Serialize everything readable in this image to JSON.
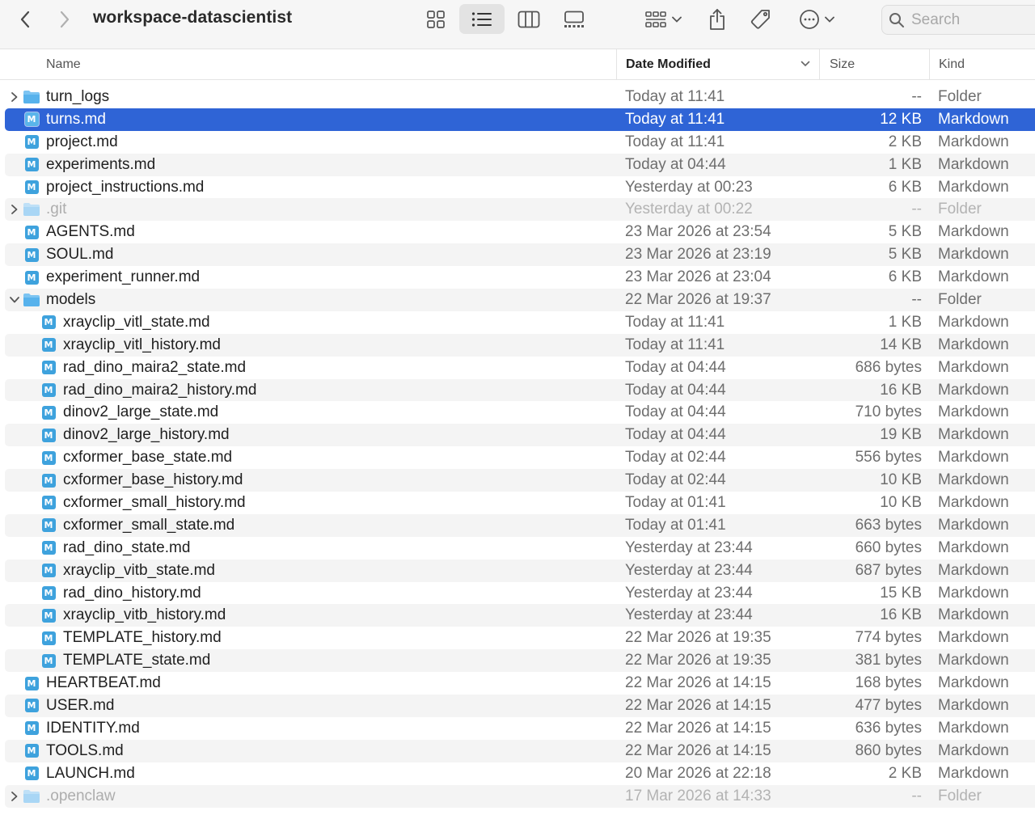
{
  "window": {
    "title": "workspace-datascientist"
  },
  "search": {
    "placeholder": "Search"
  },
  "columns": {
    "name": "Name",
    "date": "Date Modified",
    "size": "Size",
    "kind": "Kind"
  },
  "colors": {
    "selection": "#2f64d6",
    "folder": "#57b2ec",
    "markdown_icon": "#3ea2dd"
  },
  "icons": {
    "toolbar": [
      "chevron-left-icon",
      "chevron-right-icon",
      "grid-view-icon",
      "list-view-icon",
      "columns-view-icon",
      "gallery-view-icon",
      "group-icon",
      "share-icon",
      "tag-icon",
      "more-icon",
      "search-icon"
    ],
    "file_types": {
      "folder": "folder-icon",
      "markdown": "markdown-file-icon"
    }
  },
  "files": [
    {
      "name": "turn_logs",
      "date": "Today at 11:41",
      "size": "--",
      "kind": "Folder",
      "type": "folder",
      "level": 0,
      "expanded": false,
      "hidden": false,
      "selected": false
    },
    {
      "name": "turns.md",
      "date": "Today at 11:41",
      "size": "12 KB",
      "kind": "Markdown",
      "type": "md",
      "level": 0,
      "selected": true
    },
    {
      "name": "project.md",
      "date": "Today at 11:41",
      "size": "2 KB",
      "kind": "Markdown",
      "type": "md",
      "level": 0
    },
    {
      "name": "experiments.md",
      "date": "Today at 04:44",
      "size": "1 KB",
      "kind": "Markdown",
      "type": "md",
      "level": 0
    },
    {
      "name": "project_instructions.md",
      "date": "Yesterday at 00:23",
      "size": "6 KB",
      "kind": "Markdown",
      "type": "md",
      "level": 0
    },
    {
      "name": ".git",
      "date": "Yesterday at 00:22",
      "size": "--",
      "kind": "Folder",
      "type": "folder",
      "level": 0,
      "expanded": false,
      "hidden": true
    },
    {
      "name": "AGENTS.md",
      "date": "23 Mar 2026 at 23:54",
      "size": "5 KB",
      "kind": "Markdown",
      "type": "md",
      "level": 0
    },
    {
      "name": "SOUL.md",
      "date": "23 Mar 2026 at 23:19",
      "size": "5 KB",
      "kind": "Markdown",
      "type": "md",
      "level": 0
    },
    {
      "name": "experiment_runner.md",
      "date": "23 Mar 2026 at 23:04",
      "size": "6 KB",
      "kind": "Markdown",
      "type": "md",
      "level": 0
    },
    {
      "name": "models",
      "date": "22 Mar 2026 at 19:37",
      "size": "--",
      "kind": "Folder",
      "type": "folder",
      "level": 0,
      "expanded": true,
      "hidden": false
    },
    {
      "name": "xrayclip_vitl_state.md",
      "date": "Today at 11:41",
      "size": "1 KB",
      "kind": "Markdown",
      "type": "md",
      "level": 1
    },
    {
      "name": "xrayclip_vitl_history.md",
      "date": "Today at 11:41",
      "size": "14 KB",
      "kind": "Markdown",
      "type": "md",
      "level": 1
    },
    {
      "name": "rad_dino_maira2_state.md",
      "date": "Today at 04:44",
      "size": "686 bytes",
      "kind": "Markdown",
      "type": "md",
      "level": 1
    },
    {
      "name": "rad_dino_maira2_history.md",
      "date": "Today at 04:44",
      "size": "16 KB",
      "kind": "Markdown",
      "type": "md",
      "level": 1
    },
    {
      "name": "dinov2_large_state.md",
      "date": "Today at 04:44",
      "size": "710 bytes",
      "kind": "Markdown",
      "type": "md",
      "level": 1
    },
    {
      "name": "dinov2_large_history.md",
      "date": "Today at 04:44",
      "size": "19 KB",
      "kind": "Markdown",
      "type": "md",
      "level": 1
    },
    {
      "name": "cxformer_base_state.md",
      "date": "Today at 02:44",
      "size": "556 bytes",
      "kind": "Markdown",
      "type": "md",
      "level": 1
    },
    {
      "name": "cxformer_base_history.md",
      "date": "Today at 02:44",
      "size": "10 KB",
      "kind": "Markdown",
      "type": "md",
      "level": 1
    },
    {
      "name": "cxformer_small_history.md",
      "date": "Today at 01:41",
      "size": "10 KB",
      "kind": "Markdown",
      "type": "md",
      "level": 1
    },
    {
      "name": "cxformer_small_state.md",
      "date": "Today at 01:41",
      "size": "663 bytes",
      "kind": "Markdown",
      "type": "md",
      "level": 1
    },
    {
      "name": "rad_dino_state.md",
      "date": "Yesterday at 23:44",
      "size": "660 bytes",
      "kind": "Markdown",
      "type": "md",
      "level": 1
    },
    {
      "name": "xrayclip_vitb_state.md",
      "date": "Yesterday at 23:44",
      "size": "687 bytes",
      "kind": "Markdown",
      "type": "md",
      "level": 1
    },
    {
      "name": "rad_dino_history.md",
      "date": "Yesterday at 23:44",
      "size": "15 KB",
      "kind": "Markdown",
      "type": "md",
      "level": 1
    },
    {
      "name": "xrayclip_vitb_history.md",
      "date": "Yesterday at 23:44",
      "size": "16 KB",
      "kind": "Markdown",
      "type": "md",
      "level": 1
    },
    {
      "name": "TEMPLATE_history.md",
      "date": "22 Mar 2026 at 19:35",
      "size": "774 bytes",
      "kind": "Markdown",
      "type": "md",
      "level": 1
    },
    {
      "name": "TEMPLATE_state.md",
      "date": "22 Mar 2026 at 19:35",
      "size": "381 bytes",
      "kind": "Markdown",
      "type": "md",
      "level": 1
    },
    {
      "name": "HEARTBEAT.md",
      "date": "22 Mar 2026 at 14:15",
      "size": "168 bytes",
      "kind": "Markdown",
      "type": "md",
      "level": 0
    },
    {
      "name": "USER.md",
      "date": "22 Mar 2026 at 14:15",
      "size": "477 bytes",
      "kind": "Markdown",
      "type": "md",
      "level": 0
    },
    {
      "name": "IDENTITY.md",
      "date": "22 Mar 2026 at 14:15",
      "size": "636 bytes",
      "kind": "Markdown",
      "type": "md",
      "level": 0
    },
    {
      "name": "TOOLS.md",
      "date": "22 Mar 2026 at 14:15",
      "size": "860 bytes",
      "kind": "Markdown",
      "type": "md",
      "level": 0
    },
    {
      "name": "LAUNCH.md",
      "date": "20 Mar 2026 at 22:18",
      "size": "2 KB",
      "kind": "Markdown",
      "type": "md",
      "level": 0
    },
    {
      "name": ".openclaw",
      "date": "17 Mar 2026 at 14:33",
      "size": "--",
      "kind": "Folder",
      "type": "folder",
      "level": 0,
      "expanded": false,
      "hidden": true
    }
  ]
}
